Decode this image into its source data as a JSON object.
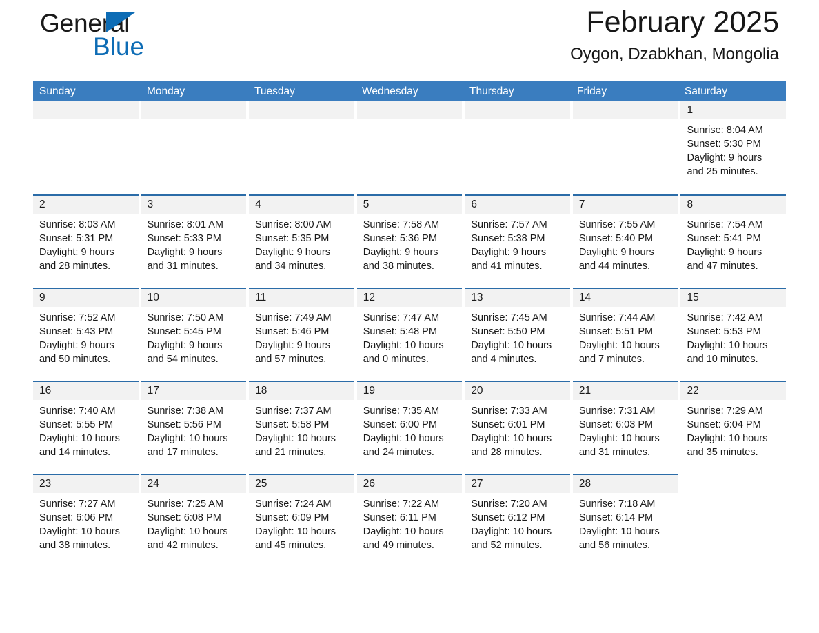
{
  "brand": {
    "name_dark": "General",
    "name_blue": "Blue",
    "flag_icon": "blue-triangle-icon"
  },
  "header": {
    "title": "February 2025",
    "subtitle": "Oygon, Dzabkhan, Mongolia"
  },
  "colors": {
    "header_blue": "#3a7dbf",
    "row_rule_blue": "#2b6ca8",
    "daynum_band": "#f2f2f2",
    "brand_blue": "#0d6cb5",
    "text": "#1a1a1a"
  },
  "weekdays": [
    "Sunday",
    "Monday",
    "Tuesday",
    "Wednesday",
    "Thursday",
    "Friday",
    "Saturday"
  ],
  "labels": {
    "sunrise_prefix": "Sunrise:",
    "sunset_prefix": "Sunset:",
    "daylight_prefix": "Daylight:"
  },
  "weeks": [
    [
      {
        "blank": true
      },
      {
        "blank": true
      },
      {
        "blank": true
      },
      {
        "blank": true
      },
      {
        "blank": true
      },
      {
        "blank": true
      },
      {
        "day": "1",
        "sunrise": "Sunrise: 8:04 AM",
        "sunset": "Sunset: 5:30 PM",
        "daylight_line1": "Daylight: 9 hours",
        "daylight_line2": "and 25 minutes."
      }
    ],
    [
      {
        "day": "2",
        "sunrise": "Sunrise: 8:03 AM",
        "sunset": "Sunset: 5:31 PM",
        "daylight_line1": "Daylight: 9 hours",
        "daylight_line2": "and 28 minutes."
      },
      {
        "day": "3",
        "sunrise": "Sunrise: 8:01 AM",
        "sunset": "Sunset: 5:33 PM",
        "daylight_line1": "Daylight: 9 hours",
        "daylight_line2": "and 31 minutes."
      },
      {
        "day": "4",
        "sunrise": "Sunrise: 8:00 AM",
        "sunset": "Sunset: 5:35 PM",
        "daylight_line1": "Daylight: 9 hours",
        "daylight_line2": "and 34 minutes."
      },
      {
        "day": "5",
        "sunrise": "Sunrise: 7:58 AM",
        "sunset": "Sunset: 5:36 PM",
        "daylight_line1": "Daylight: 9 hours",
        "daylight_line2": "and 38 minutes."
      },
      {
        "day": "6",
        "sunrise": "Sunrise: 7:57 AM",
        "sunset": "Sunset: 5:38 PM",
        "daylight_line1": "Daylight: 9 hours",
        "daylight_line2": "and 41 minutes."
      },
      {
        "day": "7",
        "sunrise": "Sunrise: 7:55 AM",
        "sunset": "Sunset: 5:40 PM",
        "daylight_line1": "Daylight: 9 hours",
        "daylight_line2": "and 44 minutes."
      },
      {
        "day": "8",
        "sunrise": "Sunrise: 7:54 AM",
        "sunset": "Sunset: 5:41 PM",
        "daylight_line1": "Daylight: 9 hours",
        "daylight_line2": "and 47 minutes."
      }
    ],
    [
      {
        "day": "9",
        "sunrise": "Sunrise: 7:52 AM",
        "sunset": "Sunset: 5:43 PM",
        "daylight_line1": "Daylight: 9 hours",
        "daylight_line2": "and 50 minutes."
      },
      {
        "day": "10",
        "sunrise": "Sunrise: 7:50 AM",
        "sunset": "Sunset: 5:45 PM",
        "daylight_line1": "Daylight: 9 hours",
        "daylight_line2": "and 54 minutes."
      },
      {
        "day": "11",
        "sunrise": "Sunrise: 7:49 AM",
        "sunset": "Sunset: 5:46 PM",
        "daylight_line1": "Daylight: 9 hours",
        "daylight_line2": "and 57 minutes."
      },
      {
        "day": "12",
        "sunrise": "Sunrise: 7:47 AM",
        "sunset": "Sunset: 5:48 PM",
        "daylight_line1": "Daylight: 10 hours",
        "daylight_line2": "and 0 minutes."
      },
      {
        "day": "13",
        "sunrise": "Sunrise: 7:45 AM",
        "sunset": "Sunset: 5:50 PM",
        "daylight_line1": "Daylight: 10 hours",
        "daylight_line2": "and 4 minutes."
      },
      {
        "day": "14",
        "sunrise": "Sunrise: 7:44 AM",
        "sunset": "Sunset: 5:51 PM",
        "daylight_line1": "Daylight: 10 hours",
        "daylight_line2": "and 7 minutes."
      },
      {
        "day": "15",
        "sunrise": "Sunrise: 7:42 AM",
        "sunset": "Sunset: 5:53 PM",
        "daylight_line1": "Daylight: 10 hours",
        "daylight_line2": "and 10 minutes."
      }
    ],
    [
      {
        "day": "16",
        "sunrise": "Sunrise: 7:40 AM",
        "sunset": "Sunset: 5:55 PM",
        "daylight_line1": "Daylight: 10 hours",
        "daylight_line2": "and 14 minutes."
      },
      {
        "day": "17",
        "sunrise": "Sunrise: 7:38 AM",
        "sunset": "Sunset: 5:56 PM",
        "daylight_line1": "Daylight: 10 hours",
        "daylight_line2": "and 17 minutes."
      },
      {
        "day": "18",
        "sunrise": "Sunrise: 7:37 AM",
        "sunset": "Sunset: 5:58 PM",
        "daylight_line1": "Daylight: 10 hours",
        "daylight_line2": "and 21 minutes."
      },
      {
        "day": "19",
        "sunrise": "Sunrise: 7:35 AM",
        "sunset": "Sunset: 6:00 PM",
        "daylight_line1": "Daylight: 10 hours",
        "daylight_line2": "and 24 minutes."
      },
      {
        "day": "20",
        "sunrise": "Sunrise: 7:33 AM",
        "sunset": "Sunset: 6:01 PM",
        "daylight_line1": "Daylight: 10 hours",
        "daylight_line2": "and 28 minutes."
      },
      {
        "day": "21",
        "sunrise": "Sunrise: 7:31 AM",
        "sunset": "Sunset: 6:03 PM",
        "daylight_line1": "Daylight: 10 hours",
        "daylight_line2": "and 31 minutes."
      },
      {
        "day": "22",
        "sunrise": "Sunrise: 7:29 AM",
        "sunset": "Sunset: 6:04 PM",
        "daylight_line1": "Daylight: 10 hours",
        "daylight_line2": "and 35 minutes."
      }
    ],
    [
      {
        "day": "23",
        "sunrise": "Sunrise: 7:27 AM",
        "sunset": "Sunset: 6:06 PM",
        "daylight_line1": "Daylight: 10 hours",
        "daylight_line2": "and 38 minutes."
      },
      {
        "day": "24",
        "sunrise": "Sunrise: 7:25 AM",
        "sunset": "Sunset: 6:08 PM",
        "daylight_line1": "Daylight: 10 hours",
        "daylight_line2": "and 42 minutes."
      },
      {
        "day": "25",
        "sunrise": "Sunrise: 7:24 AM",
        "sunset": "Sunset: 6:09 PM",
        "daylight_line1": "Daylight: 10 hours",
        "daylight_line2": "and 45 minutes."
      },
      {
        "day": "26",
        "sunrise": "Sunrise: 7:22 AM",
        "sunset": "Sunset: 6:11 PM",
        "daylight_line1": "Daylight: 10 hours",
        "daylight_line2": "and 49 minutes."
      },
      {
        "day": "27",
        "sunrise": "Sunrise: 7:20 AM",
        "sunset": "Sunset: 6:12 PM",
        "daylight_line1": "Daylight: 10 hours",
        "daylight_line2": "and 52 minutes."
      },
      {
        "day": "28",
        "sunrise": "Sunrise: 7:18 AM",
        "sunset": "Sunset: 6:14 PM",
        "daylight_line1": "Daylight: 10 hours",
        "daylight_line2": "and 56 minutes."
      },
      {
        "blank": true
      }
    ]
  ]
}
